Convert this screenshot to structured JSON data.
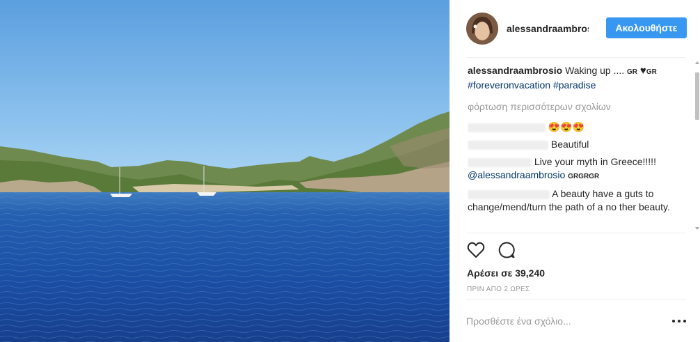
{
  "post": {
    "image_description_icon": "photo",
    "header": {
      "username": "alessandraambrosio",
      "follow_label": "Ακολουθήστε"
    },
    "caption": {
      "username": "alessandraambrosio",
      "text": "Waking up ....",
      "flag1": "GR",
      "flag2": "GR",
      "hashtags": [
        "#foreveronvacation",
        "#paradise"
      ]
    },
    "load_more": "φόρτωση περισσότερων σχολίων",
    "comments": [
      {
        "text": "😍😍😍"
      },
      {
        "text": "Beautiful"
      },
      {
        "text": "Live your myth in Greece!!!!! ",
        "mention": "@alessandraambrosio",
        "flags": "GRGRGR"
      },
      {
        "text": "A beauty have a guts to change/mend/turn the path of a no ther beauty."
      }
    ],
    "likes_label": "Αρέσει σε 39,240",
    "timestamp": "ΠΡΙΝ ΑΠΟ 2 ΩΡΕΣ",
    "add_comment_placeholder": "Προσθέστε ένα σχόλιο...",
    "icons": {
      "like": "heart-icon",
      "comment": "comment-icon",
      "more": "more-options-icon"
    }
  }
}
